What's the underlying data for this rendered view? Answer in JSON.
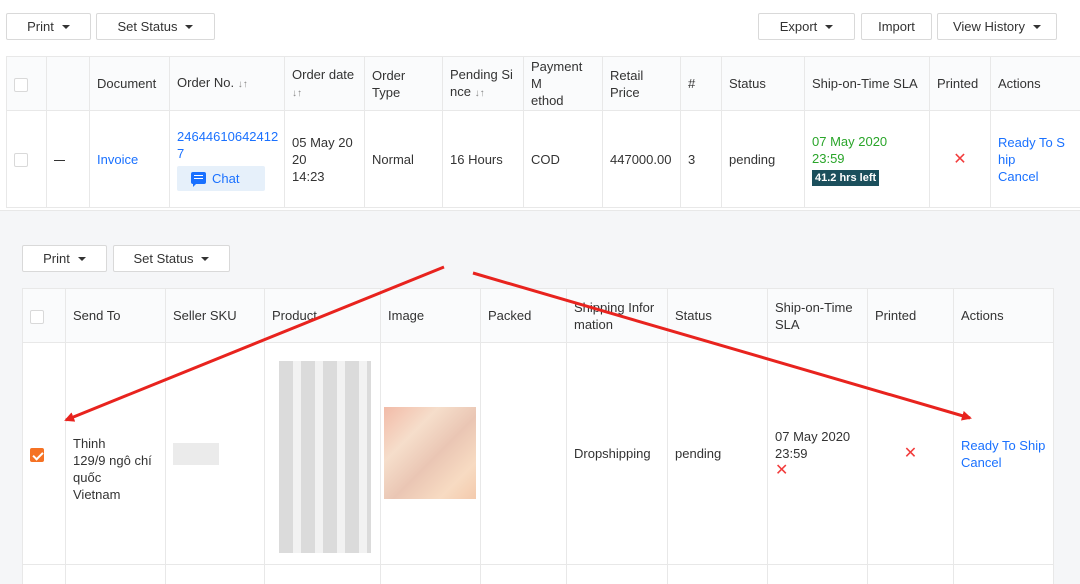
{
  "toolbar": {
    "print_label": "Print",
    "set_status_label": "Set Status",
    "export_label": "Export",
    "import_label": "Import",
    "view_history_label": "View History"
  },
  "orders_table": {
    "headers": {
      "document": "Document",
      "order_no": "Order No.",
      "order_date_1": "Order date",
      "order_type": "Order Type",
      "pending_1": "Pending Si",
      "pending_2": "nce",
      "payment_1": "Payment M",
      "payment_2": "ethod",
      "retail_price": "Retail Price",
      "count": "#",
      "status": "Status",
      "sla": "Ship-on-Time SLA",
      "printed": "Printed",
      "actions": "Actions"
    },
    "row": {
      "document": "Invoice",
      "order_no_1": "24644610642412",
      "order_no_2": "7",
      "chat_label": "Chat",
      "order_date_1": "05 May 20",
      "order_date_2": "20",
      "order_date_3": "14:23",
      "order_type": "Normal",
      "pending": "16 Hours",
      "payment": "COD",
      "retail_price": "447000.00",
      "count": "3",
      "status": "pending",
      "sla_date": "07 May 2020",
      "sla_time": "23:59",
      "sla_left": "41.2 hrs left",
      "printed_mark": "✕",
      "action_ready_1": "Ready To S",
      "action_ready_2": "hip",
      "action_cancel": "Cancel"
    }
  },
  "items_toolbar": {
    "print_label": "Print",
    "set_status_label": "Set Status"
  },
  "items_table": {
    "headers": {
      "send_to": "Send To",
      "seller_sku": "Seller SKU",
      "product": "Product",
      "image": "Image",
      "packed": "Packed",
      "shipping_1": "Shipping Infor",
      "shipping_2": "mation",
      "status": "Status",
      "sla_1": "Ship-on-Time",
      "sla_2": "SLA",
      "printed": "Printed",
      "actions": "Actions"
    },
    "row": {
      "send_to_1": "Thinh",
      "send_to_2": "129/9 ngô chí",
      "send_to_3": "quốc",
      "send_to_4": "Vietnam",
      "shipping": "Dropshipping",
      "status": "pending",
      "sla_date": "07 May 2020",
      "sla_time": "23:59",
      "sla_mark": "✕",
      "printed_mark": "✕",
      "action_ready": "Ready To Ship",
      "action_cancel": "Cancel"
    }
  },
  "colors": {
    "accent_orange": "#f57224",
    "link_blue": "#1a71ff",
    "arrow_red": "#e8231e",
    "sla_green": "#2aa52a",
    "sla_badge_bg": "#1b4f5c"
  },
  "icons": [
    "caret-down-icon",
    "sort-icon",
    "chat-icon",
    "close-icon",
    "checkbox-checked-icon",
    "annotation-arrow-icon"
  ]
}
